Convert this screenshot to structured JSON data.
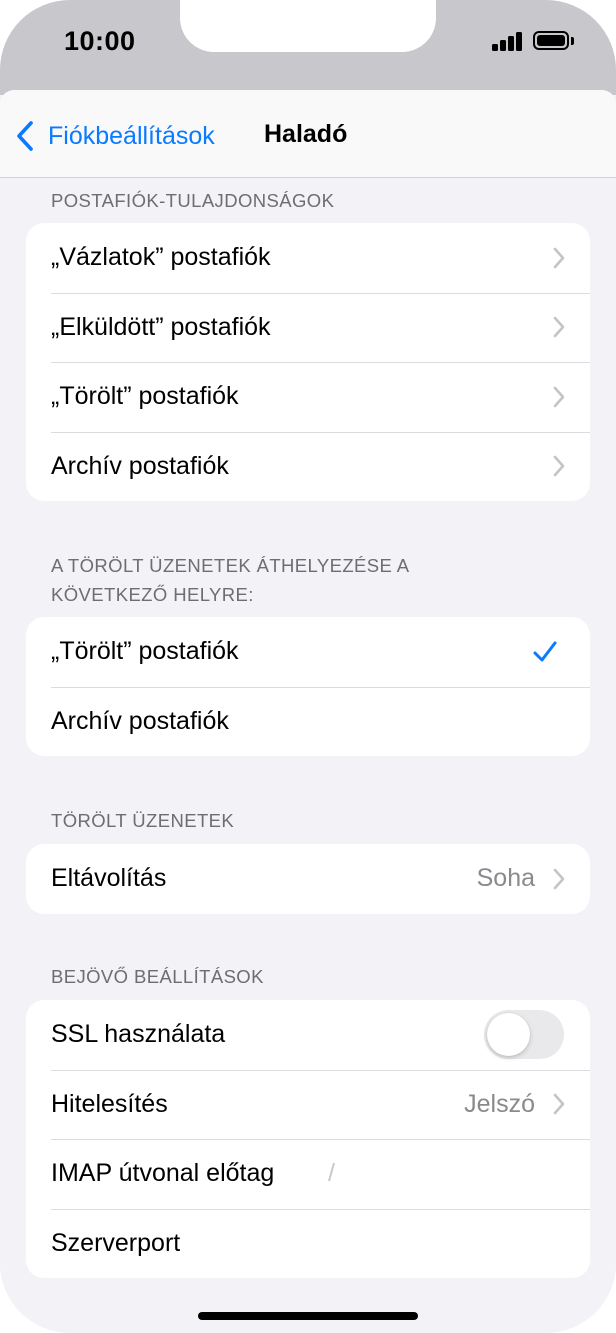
{
  "status_bar": {
    "time": "10:00",
    "signal_bars": 4,
    "battery_level": 1.0
  },
  "nav": {
    "back_label": "Fiókbeállítások",
    "title": "Haladó"
  },
  "colors": {
    "accent": "#0a7aff",
    "background": "#f2f2f7",
    "secondary_text": "#8a8a8e"
  },
  "sections": {
    "mailbox_properties": {
      "header": "POSTAFIÓK-TULAJDONSÁGOK",
      "rows": [
        {
          "label": "„Vázlatok” postafiók"
        },
        {
          "label": "„Elküldött” postafiók"
        },
        {
          "label": "„Törölt” postafiók"
        },
        {
          "label": "Archív postafiók"
        }
      ]
    },
    "move_deleted": {
      "header_line1": "A TÖRÖLT ÜZENETEK ÁTHELYEZÉSE A",
      "header_line2": "KÖVETKEZŐ HELYRE:",
      "rows": [
        {
          "label": "„Törölt” postafiók",
          "selected": true
        },
        {
          "label": "Archív postafiók",
          "selected": false
        }
      ]
    },
    "deleted_messages": {
      "header": "TÖRÖLT ÜZENETEK",
      "remove_label": "Eltávolítás",
      "remove_value": "Soha"
    },
    "incoming_settings": {
      "header": "BEJÖVŐ BEÁLLÍTÁSOK",
      "ssl_label": "SSL használata",
      "ssl_enabled": false,
      "auth_label": "Hitelesítés",
      "auth_value": "Jelszó",
      "imap_prefix_label": "IMAP útvonal előtag",
      "imap_prefix_value": "/",
      "server_port_label": "Szerverport"
    }
  }
}
